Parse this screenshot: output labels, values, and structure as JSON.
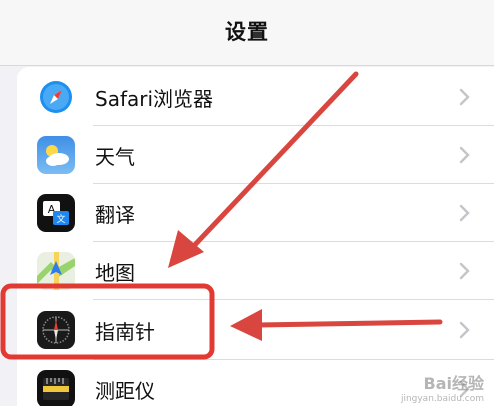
{
  "nav": {
    "title": "设置"
  },
  "settings": {
    "rows": [
      {
        "label": "Safari浏览器",
        "icon": "safari-icon"
      },
      {
        "label": "天气",
        "icon": "weather-icon"
      },
      {
        "label": "翻译",
        "icon": "translate-icon"
      },
      {
        "label": "地图",
        "icon": "maps-icon"
      },
      {
        "label": "指南针",
        "icon": "compass-icon"
      },
      {
        "label": "测距仪",
        "icon": "measure-icon"
      }
    ]
  },
  "annotation": {
    "highlight_color": "#e03a33",
    "arrow_color": "#d9463f"
  },
  "watermark": {
    "main": "Bai经验",
    "sub": "jingyan.baidu.com"
  }
}
